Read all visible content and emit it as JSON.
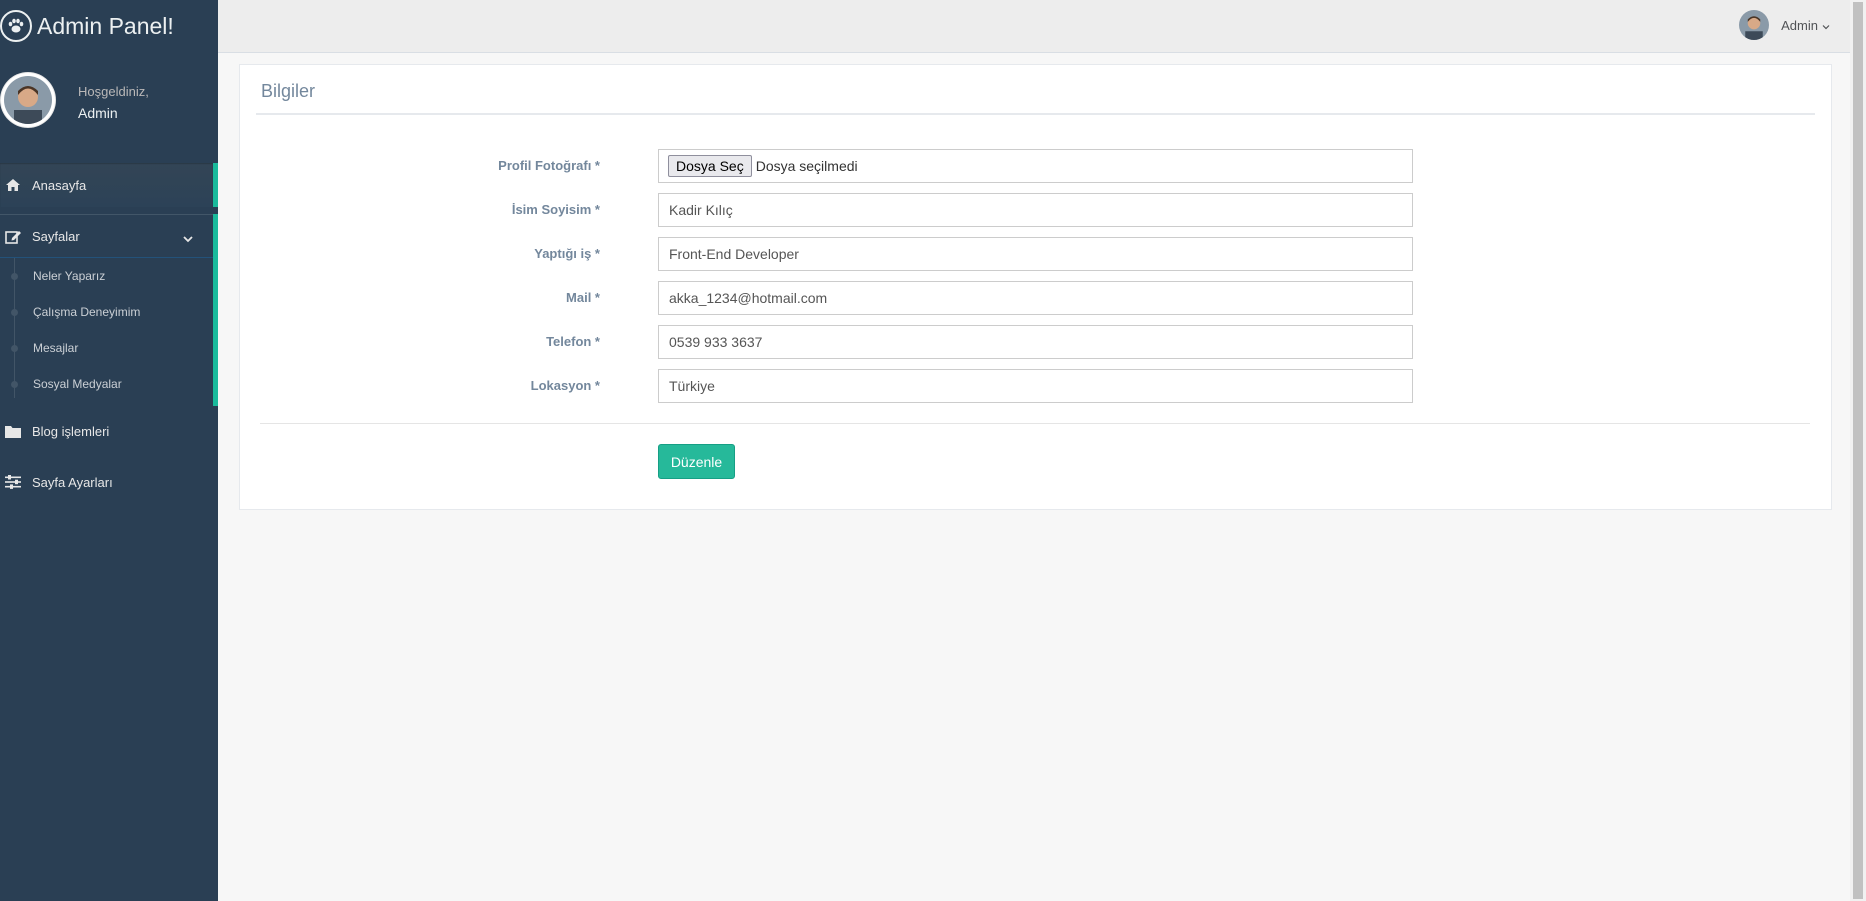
{
  "brand": {
    "title": "Admin Panel!",
    "icon": "paw-icon"
  },
  "profile": {
    "welcome": "Hoşgeldiniz,",
    "name": "Admin"
  },
  "sidebar": {
    "items": [
      {
        "label": "Anasayfa",
        "icon": "home-icon"
      },
      {
        "label": "Sayfalar",
        "icon": "edit-icon",
        "children": [
          "Neler Yaparız",
          "Çalışma Deneyimim",
          "Mesajlar",
          "Sosyal Medyalar"
        ]
      },
      {
        "label": "Blog işlemleri",
        "icon": "folder-icon"
      },
      {
        "label": "Sayfa Ayarları",
        "icon": "sliders-icon"
      }
    ]
  },
  "topbar": {
    "user": "Admin"
  },
  "panel": {
    "title": "Bilgiler",
    "fields": [
      {
        "label": "Profil Fotoğrafı *",
        "button": "Dosya Seç",
        "status": "Dosya seçilmedi"
      },
      {
        "label": "İsim Soyisim *",
        "value": "Kadir Kılıç"
      },
      {
        "label": "Yaptığı iş *",
        "value": "Front-End Developer"
      },
      {
        "label": "Mail *",
        "value": "akka_1234@hotmail.com"
      },
      {
        "label": "Telefon *",
        "value": "0539 933 3637"
      },
      {
        "label": "Lokasyon *",
        "value": "Türkiye"
      }
    ],
    "submit": "Düzenle"
  },
  "colors": {
    "sidebar": "#2A3F54",
    "accent": "#1ABB9C",
    "button": "#26B99A"
  }
}
